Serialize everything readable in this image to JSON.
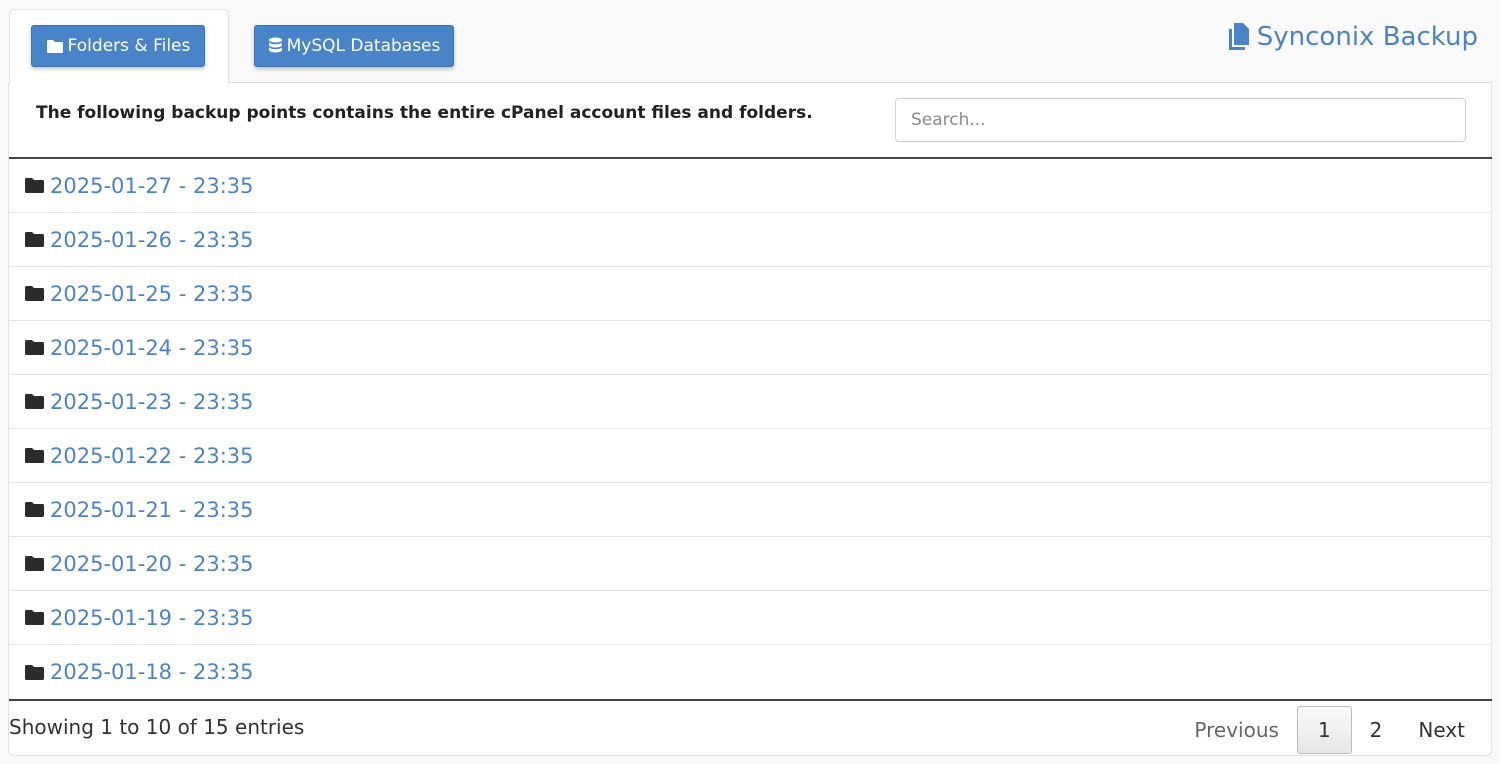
{
  "tabs": [
    {
      "label": "Folders & Files",
      "icon": "folder-icon",
      "active": true
    },
    {
      "label": "MySQL Databases",
      "icon": "database-icon",
      "active": false
    }
  ],
  "brand": {
    "label": "Synconix Backup",
    "icon": "copy-icon"
  },
  "intro": "The following backup points contains the entire cPanel account files and folders.",
  "search": {
    "placeholder": "Search...",
    "value": ""
  },
  "backups": [
    "2025-01-27 - 23:35",
    "2025-01-26 - 23:35",
    "2025-01-25 - 23:35",
    "2025-01-24 - 23:35",
    "2025-01-23 - 23:35",
    "2025-01-22 - 23:35",
    "2025-01-21 - 23:35",
    "2025-01-20 - 23:35",
    "2025-01-19 - 23:35",
    "2025-01-18 - 23:35"
  ],
  "footer": {
    "info": "Showing 1 to 10 of 15 entries",
    "previous": "Previous",
    "pages": [
      "1",
      "2"
    ],
    "current_page": "1",
    "next": "Next"
  },
  "colors": {
    "accent": "#4a84c8",
    "text": "#222222"
  }
}
